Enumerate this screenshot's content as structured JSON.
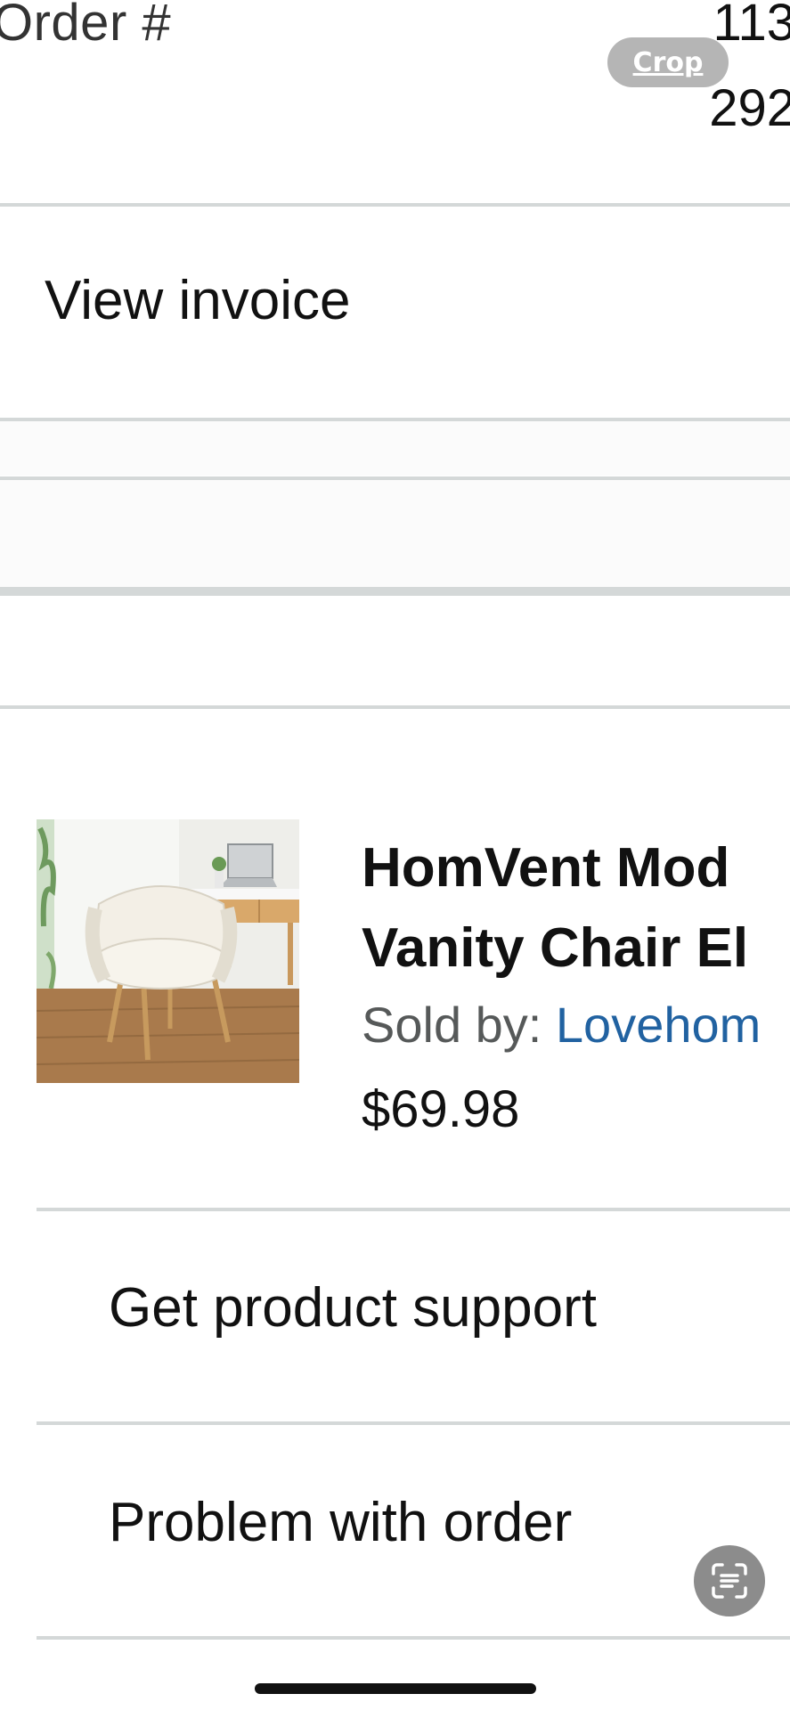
{
  "order": {
    "label": "Order #",
    "number_line1": "113",
    "number_line2": "292"
  },
  "overlay": {
    "crop_label": "Crop",
    "scan_icon": "text-scan-icon"
  },
  "actions": {
    "view_invoice": "View invoice"
  },
  "product": {
    "image_icon": "product-image-white-fluffy-chair",
    "title_line1": "HomVent Mod",
    "title_line2": "Vanity Chair El",
    "sold_by_label": "Sold by: ",
    "seller": "Lovehom",
    "price": "$69.98"
  },
  "item_actions": {
    "product_support": "Get product support",
    "problem_with_order": "Problem with order"
  },
  "colors": {
    "divider": "#d4d8d8",
    "link": "#2162a1",
    "secondary_text": "#565959"
  }
}
